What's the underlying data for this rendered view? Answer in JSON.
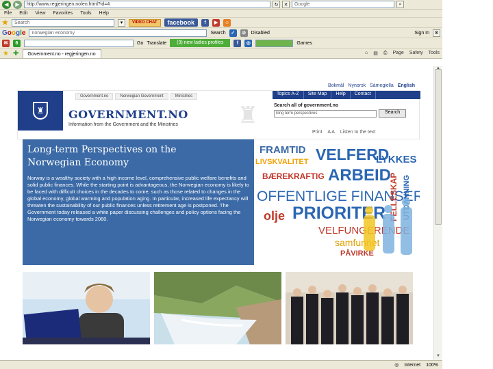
{
  "browser": {
    "address_url": "http://www.regjeringen.no/en.html?id=4",
    "top_search_placeholder": "Google",
    "menu": [
      "File",
      "Edit",
      "View",
      "Favorites",
      "Tools",
      "Help"
    ],
    "toolbar1": {
      "search_placeholder": "Search",
      "video_chat": "VIDEO CHAT",
      "facebook": "facebook"
    },
    "toolbar2": {
      "google_field": "norwegian economy",
      "search_label": "Search",
      "disabled_label": "Disabled",
      "sign_in": "Sign In"
    },
    "toolbar3": {
      "go_label": "Go",
      "translate_label": "Translate",
      "profiles_button": "(9) new ladies profiles",
      "games_label": "Games"
    },
    "tab_title": "Government.no - regjeringen.no",
    "tab_tools": [
      "Page",
      "Safety",
      "Tools"
    ],
    "status": {
      "zone": "Internet",
      "zoom": "100%"
    },
    "colors": {
      "gov_blue": "#1f3f8a",
      "feature_blue": "#3b6aa6",
      "profiles_green": "#4fae3a"
    }
  },
  "site": {
    "topnav": [
      "Government.no",
      "Norwegian Government",
      "Ministries"
    ],
    "languages": [
      "Bokmål",
      "Nynorsk",
      "Sámegiella",
      "English"
    ],
    "bluebar": [
      "Topics A-Z",
      "Site Map",
      "Help",
      "Contact"
    ],
    "title": "GOVERNMENT.NO",
    "subtitle": "Information from the Government and the Ministries",
    "search_label": "Search all of government.no",
    "search_value": "long term perspectives",
    "search_button": "Search",
    "utilities": [
      "Print",
      "A A",
      "Listen to the text"
    ],
    "feature": {
      "title_line1": "Long-term Perspectives on the",
      "title_line2": "Norwegian Economy",
      "body": "Norway is a wealthy society with a high income level, comprehensive public welfare benefits and solid public finances. While the starting point is advantageous, the Norwegian economy is likely to be faced with difficult choices in the decades to come, such as those related to changes in the global economy, global warming and population aging. In particular, increased life expectancy will threaten the sustainability of our public finances unless retirement age is postponed. The Government today released a white paper discussing challenges and policy options facing the Norwegian economy towards 2060."
    },
    "word_cloud": [
      "FRAMTID",
      "VELFERD",
      "LYKKES",
      "LIVSKVALITET",
      "ARBEID",
      "BÆREKRAFTIG",
      "OFFENTLIGE FINANSER",
      "olje",
      "PRIORITER",
      "VELFUNGERENDE",
      "samfunnet",
      "PÅVIRKE",
      "FELLESKAP",
      "UTDANNING"
    ]
  }
}
